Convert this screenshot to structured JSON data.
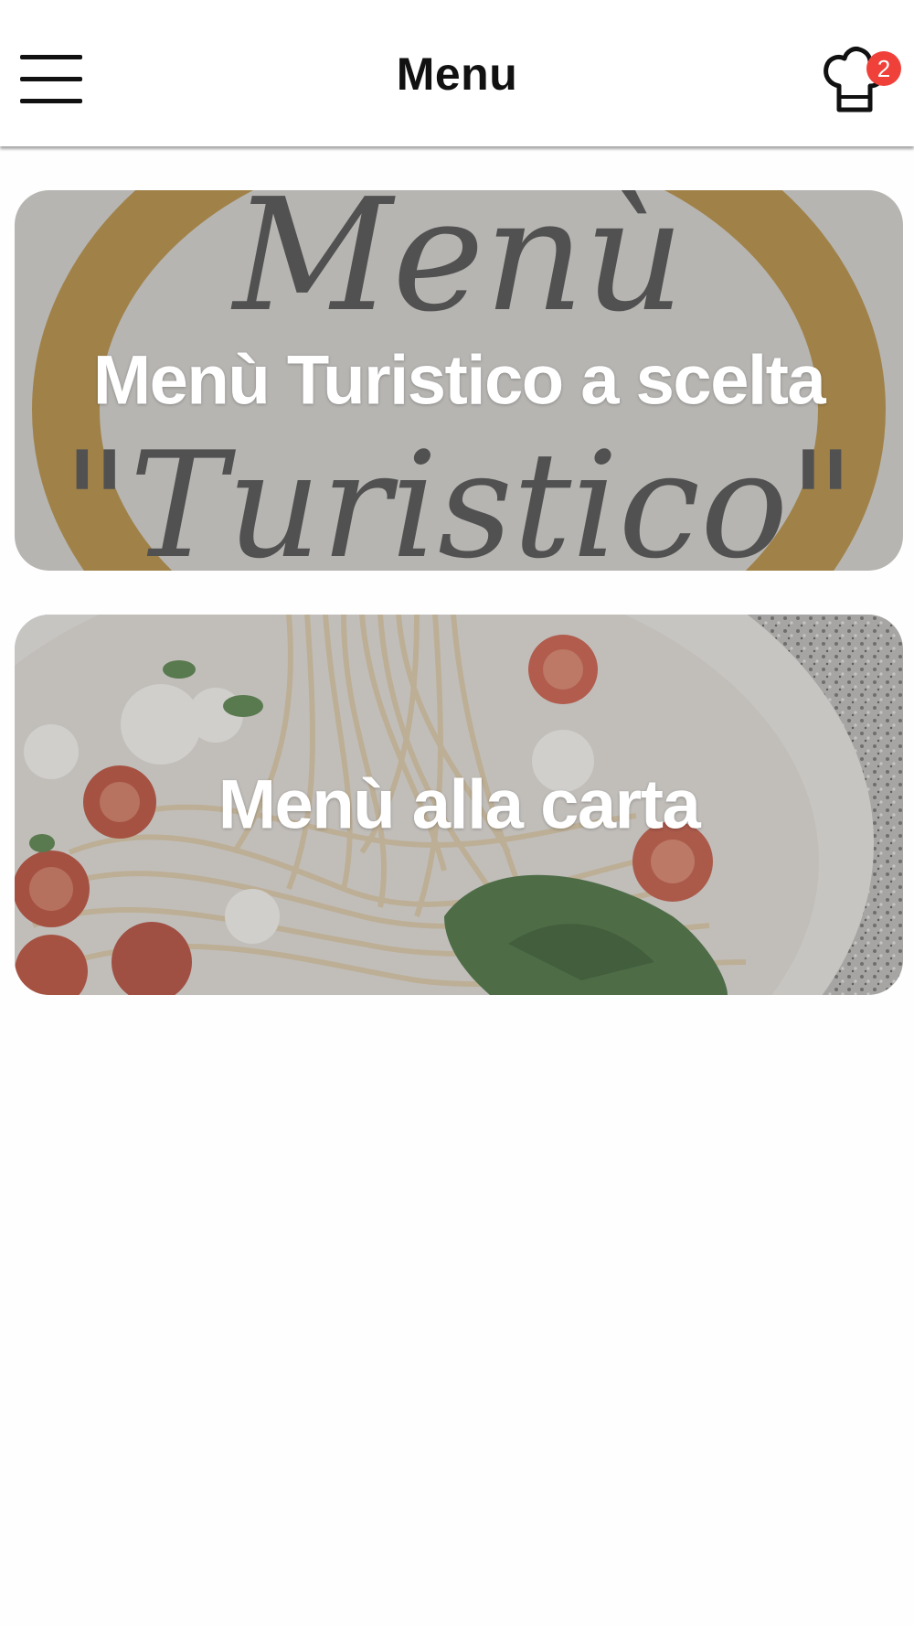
{
  "header": {
    "title": "Menu",
    "menu_icon": "hamburger-menu-icon",
    "cart_icon": "chef-hat-icon",
    "cart_count": "2"
  },
  "categories": [
    {
      "label": "Menù Turistico a scelta",
      "image_text_line1": "Menù",
      "image_text_line2": "\"Turistico\""
    },
    {
      "label": "Menù alla carta"
    }
  ],
  "colors": {
    "badge": "#f0403a",
    "header_bg": "#ffffff",
    "ring_gold": "#c8922a"
  }
}
